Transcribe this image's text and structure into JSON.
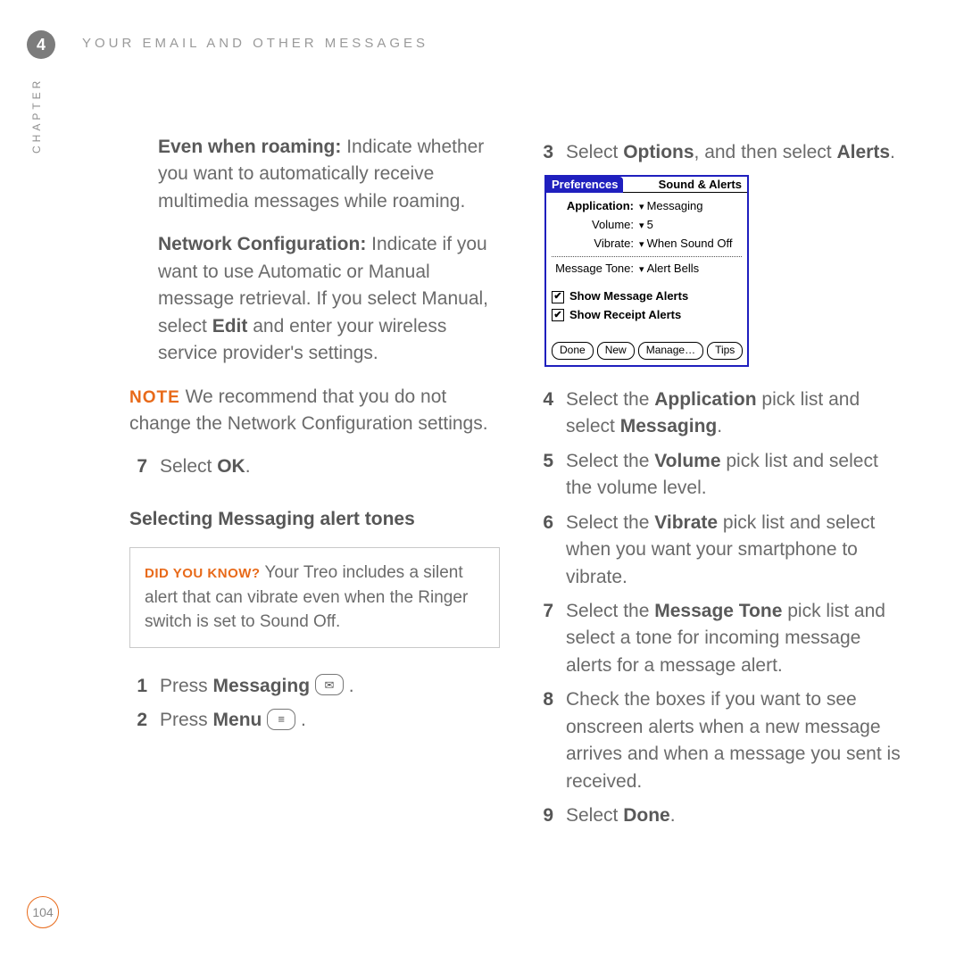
{
  "chapter_number": "4",
  "header_title": "YOUR EMAIL AND OTHER MESSAGES",
  "side_label": "CHAPTER",
  "page_number": "104",
  "left": {
    "roaming_bold": "Even when roaming:",
    "roaming_rest": " Indicate whether you want to automatically receive multimedia messages while roaming.",
    "netconf_bold": "Network Configuration:",
    "netconf_a": " Indicate if you want to use Automatic or Manual message retrieval. If you select Manual, select ",
    "netconf_edit": "Edit",
    "netconf_b": " and enter your wireless service provider's settings.",
    "note_lead": "NOTE",
    "note_body": "  We recommend that you do not change the Network Configuration settings.",
    "step7_n": "7",
    "step7_a": "Select ",
    "step7_ok": "OK",
    "step7_b": ".",
    "subhead": "Selecting Messaging alert tones",
    "didyou_lead": "DID YOU KNOW?",
    "didyou_body": "  Your Treo includes a silent alert that can vibrate even when the Ringer switch is set to Sound Off.",
    "step1_n": "1",
    "step1_a": "Press ",
    "step1_bold": "Messaging",
    "step1_b": "  ",
    "step1_icon": "✉",
    "step1_c": " .",
    "step2_n": "2",
    "step2_a": "Press ",
    "step2_bold": "Menu",
    "step2_b": "  ",
    "step2_icon": "≡",
    "step2_c": " ."
  },
  "right": {
    "step3_n": "3",
    "step3_a": "Select ",
    "step3_bold1": "Options",
    "step3_b": ", and then select ",
    "step3_bold2": "Alerts",
    "step3_c": ".",
    "step4_n": "4",
    "step4_a": "Select the ",
    "step4_bold1": "Application",
    "step4_b": " pick list and select ",
    "step4_bold2": "Messaging",
    "step4_c": ".",
    "step5_n": "5",
    "step5_a": "Select the ",
    "step5_bold": "Volume",
    "step5_b": " pick list and select the volume level.",
    "step6_n": "6",
    "step6_a": "Select the ",
    "step6_bold": "Vibrate",
    "step6_b": " pick list and select when you want your smartphone to vibrate.",
    "step7_n": "7",
    "step7_a": "Select the ",
    "step7_bold": "Message Tone",
    "step7_b": " pick list and select a tone for incoming message alerts for a message alert.",
    "step8_n": "8",
    "step8_a": "Check the boxes if you want to see onscreen alerts when a new message arrives and when a message you sent is received.",
    "step9_n": "9",
    "step9_a": "Select ",
    "step9_bold": "Done",
    "step9_b": "."
  },
  "palm": {
    "title_tab": "Preferences",
    "title_rest": "Sound & Alerts",
    "rows": {
      "app_lbl": "Application:",
      "app_val": "Messaging",
      "vol_lbl": "Volume:",
      "vol_val": "5",
      "vib_lbl": "Vibrate:",
      "vib_val": "When Sound Off",
      "tone_lbl": "Message Tone:",
      "tone_val": "Alert Bells"
    },
    "check1": "Show Message Alerts",
    "check2": "Show Receipt Alerts",
    "btn_done": "Done",
    "btn_new": "New",
    "btn_manage": "Manage…",
    "btn_tips": "Tips"
  }
}
